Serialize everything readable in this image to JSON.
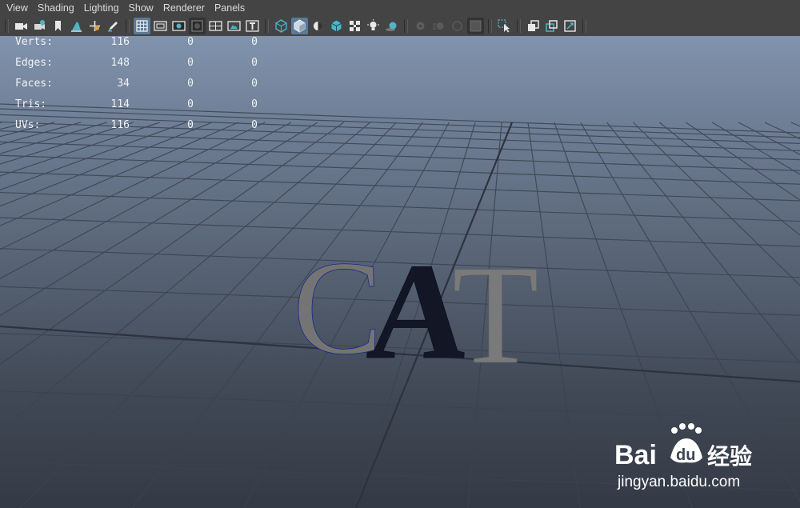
{
  "menu": [
    "View",
    "Shading",
    "Lighting",
    "Show",
    "Renderer",
    "Panels"
  ],
  "toolbar": {
    "icons": [
      "camera-icon",
      "camera-attributes-icon",
      "bookmark-icon",
      "image-plane-icon",
      "2d-pan-zoom-icon",
      "grease-pencil-icon",
      "grid-icon",
      "film-gate-icon",
      "resolution-gate-icon",
      "gate-mask-icon",
      "field-chart-icon",
      "safe-action-icon",
      "safe-title-icon",
      "wireframe-icon",
      "smooth-shade-icon",
      "use-default-material-icon",
      "wireframe-on-shaded-icon",
      "xray-icon",
      "use-lights-icon",
      "shadows-icon",
      "screen-space-ao-icon",
      "motion-blur-icon",
      "anti-aliasing-icon",
      "depth-of-field-icon",
      "isolate-select-icon",
      "xray-joints-icon",
      "xray-active-components-icon",
      "toggle-hud-icon"
    ],
    "active": [
      "grid-icon",
      "smooth-shade-icon"
    ]
  },
  "hud": {
    "rows": [
      {
        "label": "Verts:",
        "values": [
          "116",
          "0",
          "0"
        ]
      },
      {
        "label": "Edges:",
        "values": [
          "148",
          "0",
          "0"
        ]
      },
      {
        "label": "Faces:",
        "values": [
          "34",
          "0",
          "0"
        ]
      },
      {
        "label": "Tris:",
        "values": [
          "114",
          "0",
          "0"
        ]
      },
      {
        "label": "UVs:",
        "values": [
          "116",
          "0",
          "0"
        ]
      }
    ]
  },
  "scene": {
    "text_object": "CAT",
    "colors": {
      "grid_line": "#3a4250",
      "text_gray": "#767676",
      "text_selected": "#141826",
      "wire_blue": "#1b2a88"
    }
  },
  "watermark": {
    "brand": "Bai",
    "brand2": "du",
    "chinese": "经验",
    "url": "jingyan.baidu.com"
  }
}
